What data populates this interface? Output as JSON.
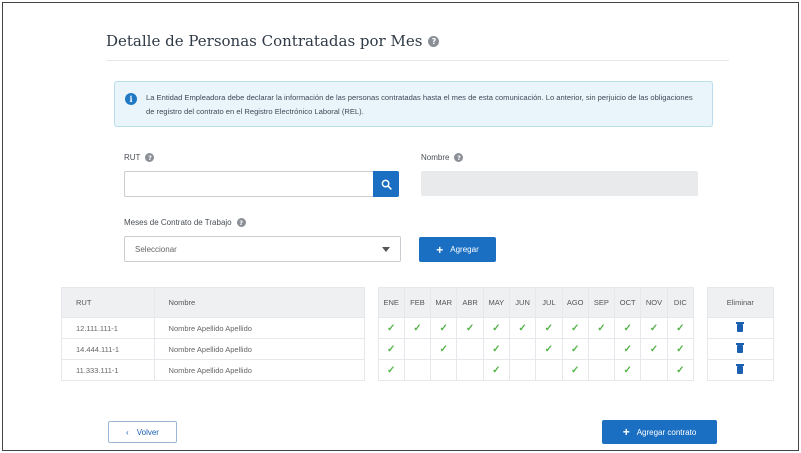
{
  "page": {
    "title": "Detalle de Personas Contratadas por Mes"
  },
  "info": {
    "text": "La Entidad Empleadora debe declarar la información de las personas contratadas hasta el mes de esta comunicación. Lo anterior, sin perjuicio de las obligaciones de registro del contrato en el Registro Electrónico Laboral (REL)."
  },
  "form": {
    "rut_label": "RUT",
    "rut_value": "",
    "nombre_label": "Nombre",
    "nombre_value": "",
    "meses_label": "Meses de Contrato de Trabajo",
    "meses_selected": "Seleccionar",
    "agregar_label": "Agregar"
  },
  "table": {
    "headers": {
      "rut": "RUT",
      "nombre": "Nombre",
      "eliminar": "Eliminar",
      "months": [
        "ENE",
        "FEB",
        "MAR",
        "ABR",
        "MAY",
        "JUN",
        "JUL",
        "AGO",
        "SEP",
        "OCT",
        "NOV",
        "DIC"
      ]
    },
    "rows": [
      {
        "rut": "12.111.111-1",
        "nombre": "Nombre Apellido Apellido",
        "months": [
          true,
          true,
          true,
          true,
          true,
          true,
          true,
          true,
          true,
          true,
          true,
          true
        ]
      },
      {
        "rut": "14.444.111-1",
        "nombre": "Nombre Apellido Apellido",
        "months": [
          true,
          false,
          true,
          false,
          true,
          false,
          true,
          true,
          false,
          true,
          true,
          true
        ]
      },
      {
        "rut": "11.333.111-1",
        "nombre": "Nombre Apellido Apellido",
        "months": [
          true,
          false,
          false,
          false,
          true,
          false,
          false,
          true,
          false,
          true,
          false,
          true
        ]
      }
    ]
  },
  "footer": {
    "volver_label": "Volver",
    "agregar_contrato_label": "Agregar contrato"
  },
  "icons": {
    "help": "question-circle-icon",
    "info": "info-circle-icon",
    "search": "search-icon",
    "caret": "chevron-down-icon",
    "plus": "plus-icon",
    "trash": "trash-icon",
    "back": "chevron-left-icon",
    "check": "check-icon"
  },
  "colors": {
    "primary": "#1a6fc2",
    "check": "#55b34a",
    "info_bg": "#eaf5fb"
  }
}
